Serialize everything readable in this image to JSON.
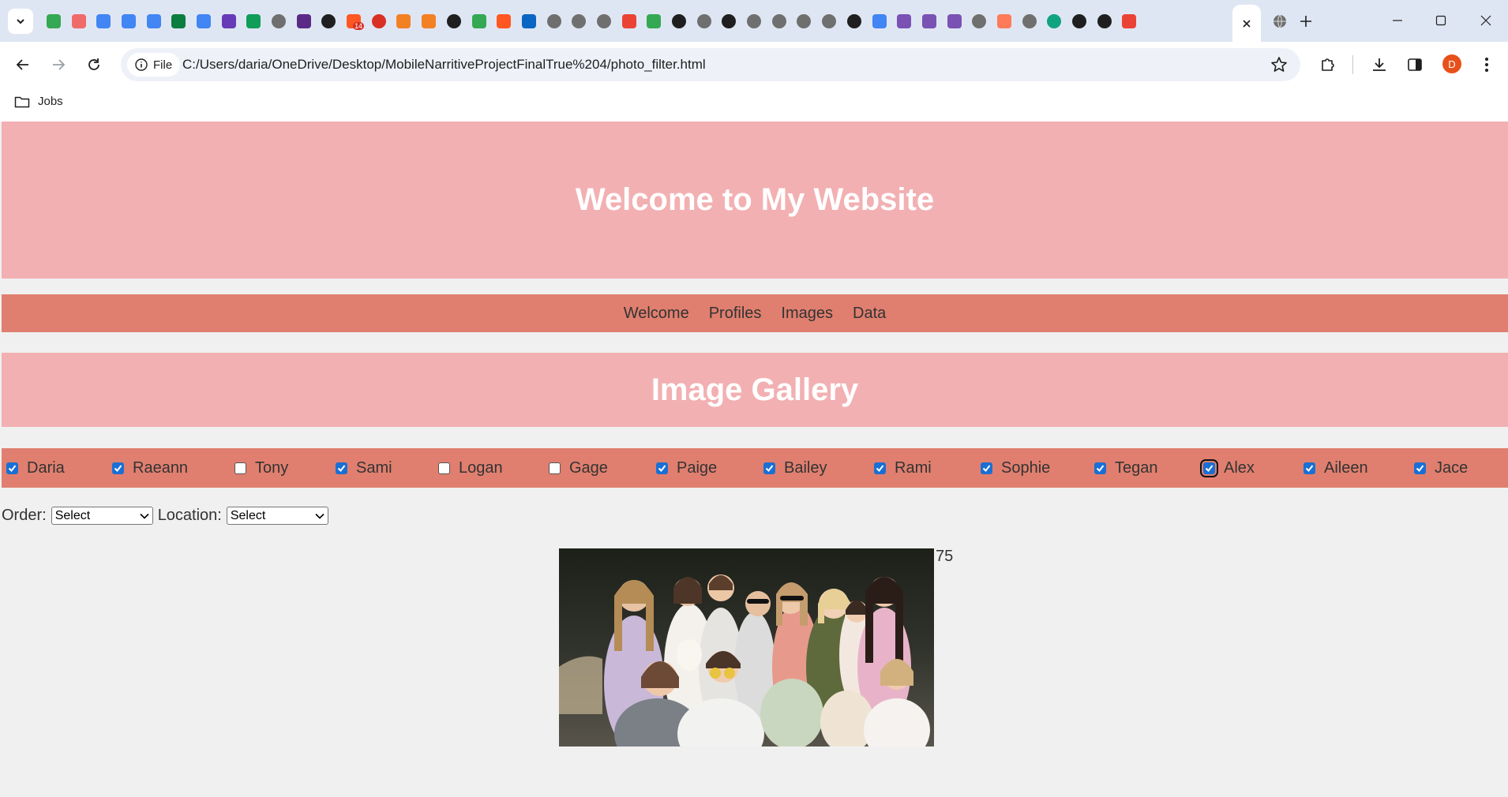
{
  "browser": {
    "url": "C:/Users/daria/OneDrive/Desktop/MobileNarritiveProjectFinalTrue%204/photo_filter.html",
    "site_chip": "File",
    "bookmark_folder": "Jobs",
    "profile_initial": "D",
    "tab_badge": "14",
    "tab_favicons": [
      "drive",
      "asana",
      "docs",
      "docs",
      "docs",
      "wix",
      "docs",
      "forms",
      "sheets",
      "globe",
      "perplexity",
      "p-app",
      "blogger",
      "notify",
      "stack",
      "stack",
      "github",
      "drive",
      "blogger",
      "linkedin",
      "globe",
      "globe",
      "globe",
      "gmail",
      "drive",
      "github",
      "globe",
      "github",
      "globe",
      "globe",
      "globe",
      "globe",
      "github",
      "google",
      "bootstrap",
      "bootstrap",
      "bootstrap",
      "globe",
      "hubspot",
      "globe",
      "chatgpt",
      "github",
      "github",
      "gmail"
    ]
  },
  "site": {
    "title": "Welcome to My Website",
    "nav": [
      "Welcome",
      "Profiles",
      "Images",
      "Data"
    ],
    "gallery_title": "Image Gallery",
    "filters": [
      {
        "name": "Daria",
        "checked": true
      },
      {
        "name": "Raeann",
        "checked": true
      },
      {
        "name": "Tony",
        "checked": false
      },
      {
        "name": "Sami",
        "checked": true
      },
      {
        "name": "Logan",
        "checked": false
      },
      {
        "name": "Gage",
        "checked": false
      },
      {
        "name": "Paige",
        "checked": true
      },
      {
        "name": "Bailey",
        "checked": true
      },
      {
        "name": "Rami",
        "checked": true
      },
      {
        "name": "Sophie",
        "checked": true
      },
      {
        "name": "Tegan",
        "checked": true
      },
      {
        "name": "Alex",
        "checked": true,
        "focused": true
      },
      {
        "name": "Aileen",
        "checked": true
      },
      {
        "name": "Jace",
        "checked": true
      }
    ],
    "order_label": "Order:",
    "order_value": "Select",
    "location_label": "Location:",
    "location_value": "Select",
    "image_number": "75"
  },
  "colors": {
    "pink_banner": "#f2b0b2",
    "salmon_bar": "#e07f6f",
    "page_bg": "#f0f0f0",
    "checkbox_blue": "#1a6fd4"
  }
}
